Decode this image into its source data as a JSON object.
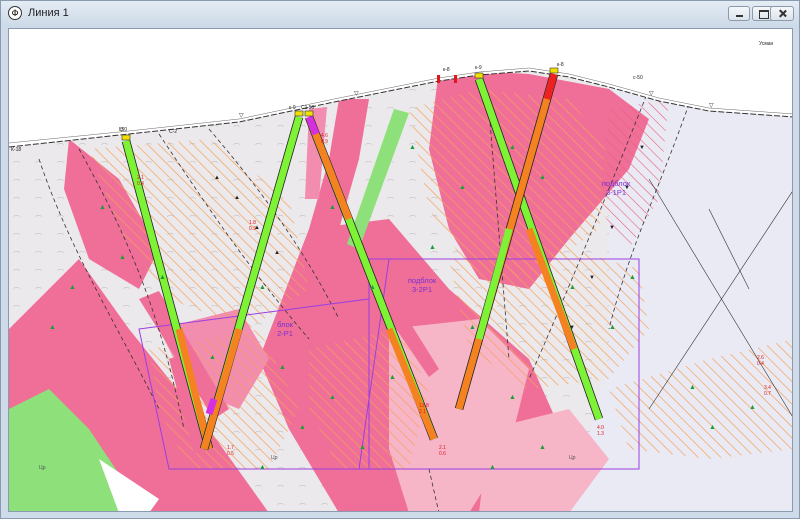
{
  "window": {
    "title": "Линия 1",
    "app_icon_label": "Ф"
  },
  "map": {
    "corner_label": "Усман",
    "blocks": [
      {
        "title": "блок",
        "code": "2-P1"
      },
      {
        "title": "подблок",
        "code": "3-2P1"
      },
      {
        "title": "подблок",
        "code": "3-1P1"
      }
    ],
    "surface_labels": [
      "К-18",
      "с50",
      "С-2",
      "к-9",
      "С1 50",
      "к-8",
      "к-9",
      "к-8",
      "с-50"
    ],
    "zone_labels": [
      "Цр",
      "Цр",
      "Цр"
    ],
    "colors": {
      "rock_pink": "#ef6f98",
      "rock_light_pink": "#f7b6c8",
      "rock_grey": "#ece9ec",
      "rock_lavender": "#eaeaf4",
      "rock_green": "#8ee07a",
      "drill_green": "#7ef235",
      "drill_orange": "#f58220",
      "block_outline": "#9b3fe0",
      "assay_red": "#e0181c"
    }
  }
}
